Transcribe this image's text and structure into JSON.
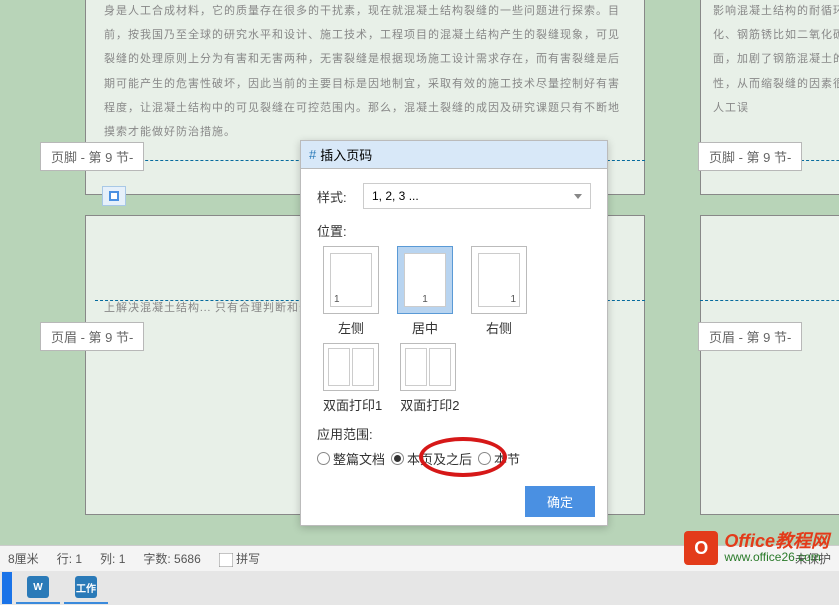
{
  "doc": {
    "body_top_left": "身是人工合成材料，它的质量存在很多的干扰素，现在就混凝土结构裂缝的一些问题进行探索。目前，按我国乃至全球的研究水平和设计、施工技术，工程项目的混凝土结构产生的裂缝现象，可见裂缝的处理原则上分为有害和无害两种，无害裂缝是根据现场施工设计需求存在，而有害裂缝是后期可能产生的危害性破坏，因此当前的主要目标是因地制宜，采取有效的施工技术尽量控制好有害程度，让混凝土结构中的可见裂缝在可控范围内。那么，混凝土裂缝的成因及研究课题只有不断地摸索才能做好防治措施。",
    "body_top_right": "影响混凝土结构的耐循环、碳化、钢筋锈比如二氧化碳、二氧面，加剧了钢筋混凝土的耐久性，从而缩裂缝的因素很多，有人工误",
    "body_bottom_left": "上解决混凝土结构... 只有合理判断和分"
  },
  "markers": {
    "footer_left": "页脚 - 第 9 节-",
    "footer_right": "页脚 - 第 9 节-",
    "header_left": "页眉 - 第 9 节-",
    "header_right": "页眉 - 第 9 节-"
  },
  "popup": {
    "title": "插入页码",
    "style_label": "样式:",
    "style_value": "1, 2, 3 ...",
    "position_label": "位置:",
    "positions": [
      {
        "label": "左侧",
        "num_pos": "left"
      },
      {
        "label": "居中",
        "num_pos": "center"
      },
      {
        "label": "右侧",
        "num_pos": "right"
      }
    ],
    "duplex": [
      {
        "label": "双面打印1"
      },
      {
        "label": "双面打印2"
      }
    ],
    "apply_label": "应用范围:",
    "apply_options": [
      {
        "label": "整篇文档",
        "checked": false
      },
      {
        "label": "本页及之后",
        "checked": true
      },
      {
        "label": "本节",
        "checked": false
      }
    ],
    "confirm": "确定"
  },
  "status": {
    "cm": "8厘米",
    "row": "行: 1",
    "col": "列: 1",
    "words": "字数: 5686",
    "spell": "拼写",
    "protect": "未保护"
  },
  "watermark": {
    "icon": "O",
    "title": "Office教程网",
    "url": "www.office26.com"
  }
}
